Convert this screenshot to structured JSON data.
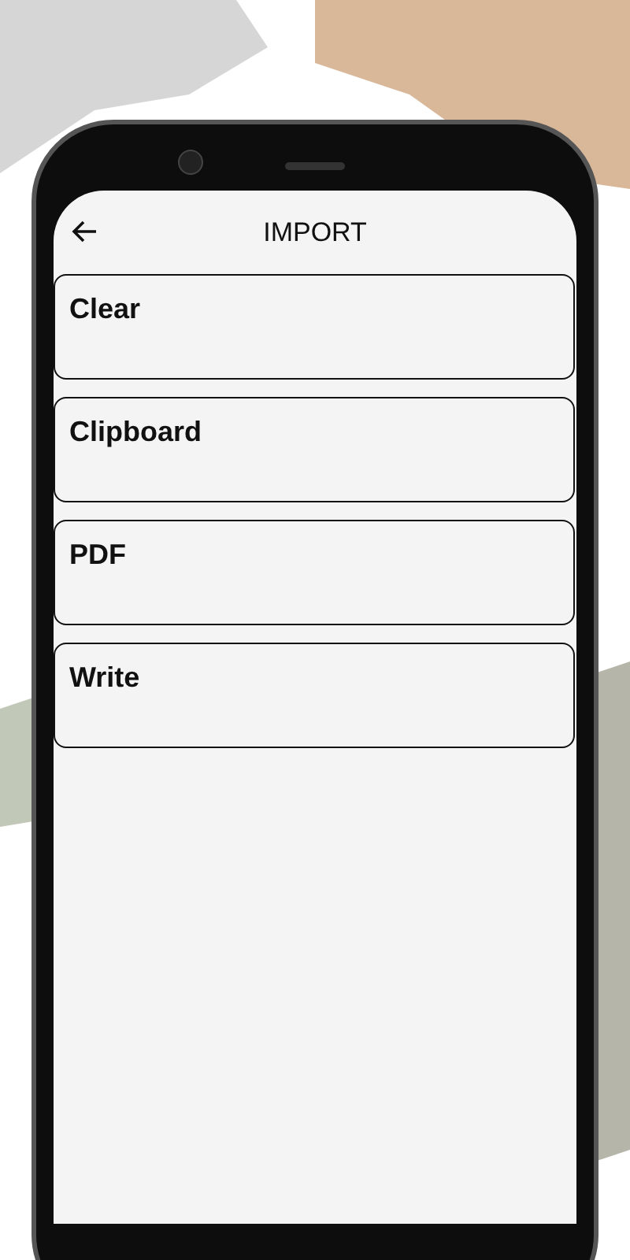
{
  "header": {
    "title": "IMPORT"
  },
  "options": [
    {
      "label": "Clear"
    },
    {
      "label": "Clipboard"
    },
    {
      "label": "PDF"
    },
    {
      "label": "Write"
    }
  ]
}
